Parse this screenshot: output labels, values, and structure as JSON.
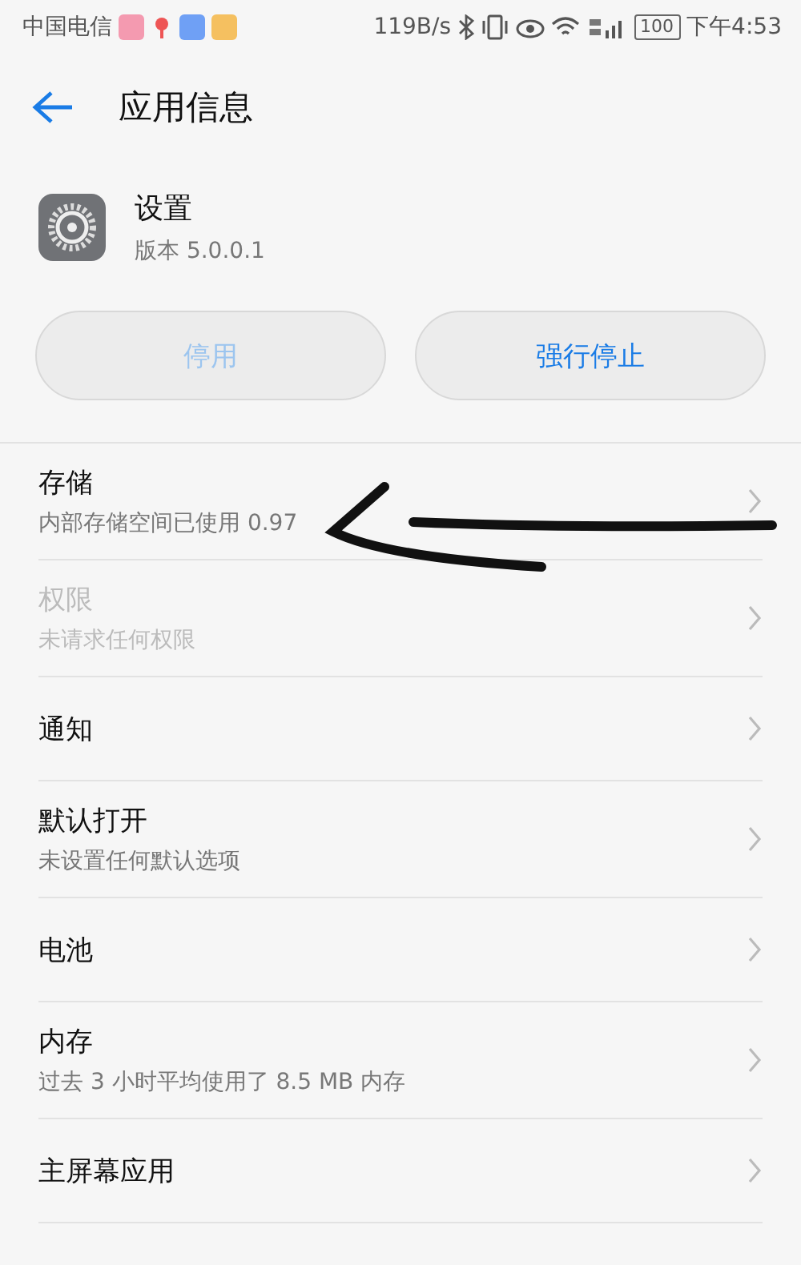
{
  "status_bar": {
    "carrier": "中国电信",
    "speed": "119B/s",
    "battery": "100",
    "time": "下午4:53"
  },
  "header": {
    "title": "应用信息"
  },
  "app": {
    "name": "设置",
    "version": "版本 5.0.0.1"
  },
  "buttons": [
    {
      "label": "停用",
      "disabled": true
    },
    {
      "label": "强行停止",
      "disabled": false
    }
  ],
  "rows": [
    {
      "title": "存储",
      "subtitle": "内部存储空间已使用 0.97",
      "disabled": false
    },
    {
      "title": "权限",
      "subtitle": "未请求任何权限",
      "disabled": true
    },
    {
      "title": "通知",
      "disabled": false
    },
    {
      "title": "默认打开",
      "subtitle": "未设置任何默认选项",
      "disabled": false
    },
    {
      "title": "电池",
      "disabled": false
    },
    {
      "title": "内存",
      "subtitle": "过去 3 小时平均使用了 8.5 MB 内存",
      "disabled": false
    },
    {
      "title": "主屏幕应用",
      "disabled": false
    }
  ]
}
